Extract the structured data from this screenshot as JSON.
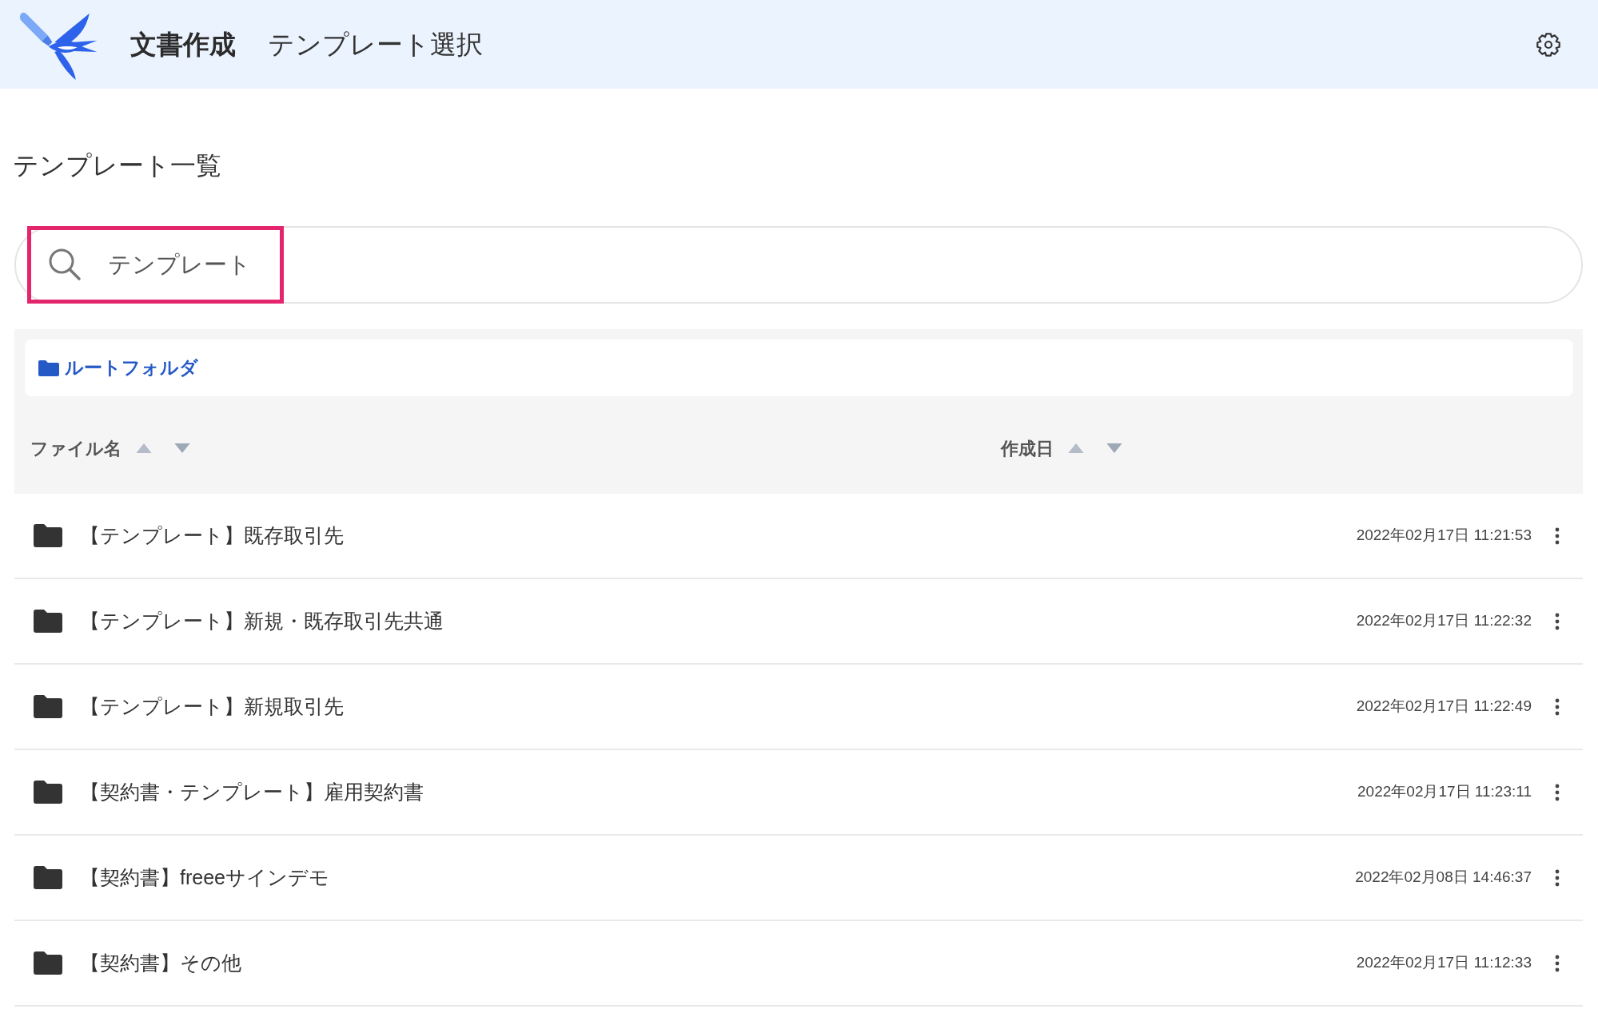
{
  "header": {
    "app_name": "文書作成",
    "page_name": "テンプレート選択"
  },
  "page_title": "テンプレート一覧",
  "search": {
    "value": "テンプレート",
    "highlighted": true
  },
  "breadcrumb": {
    "label": "ルートフォルダ"
  },
  "table": {
    "columns": [
      "ファイル名",
      "作成日"
    ],
    "rows": [
      {
        "name": "【テンプレート】既存取引先",
        "created": "2022年02月17日 11:21:53"
      },
      {
        "name": "【テンプレート】新規・既存取引先共通",
        "created": "2022年02月17日 11:22:32"
      },
      {
        "name": "【テンプレート】新規取引先",
        "created": "2022年02月17日 11:22:49"
      },
      {
        "name": "【契約書・テンプレート】雇用契約書",
        "created": "2022年02月17日 11:23:11"
      },
      {
        "name": "【契約書】freeeサインデモ",
        "created": "2022年02月08日 14:46:37"
      },
      {
        "name": "【契約書】その他",
        "created": "2022年02月17日 11:12:33"
      }
    ]
  }
}
